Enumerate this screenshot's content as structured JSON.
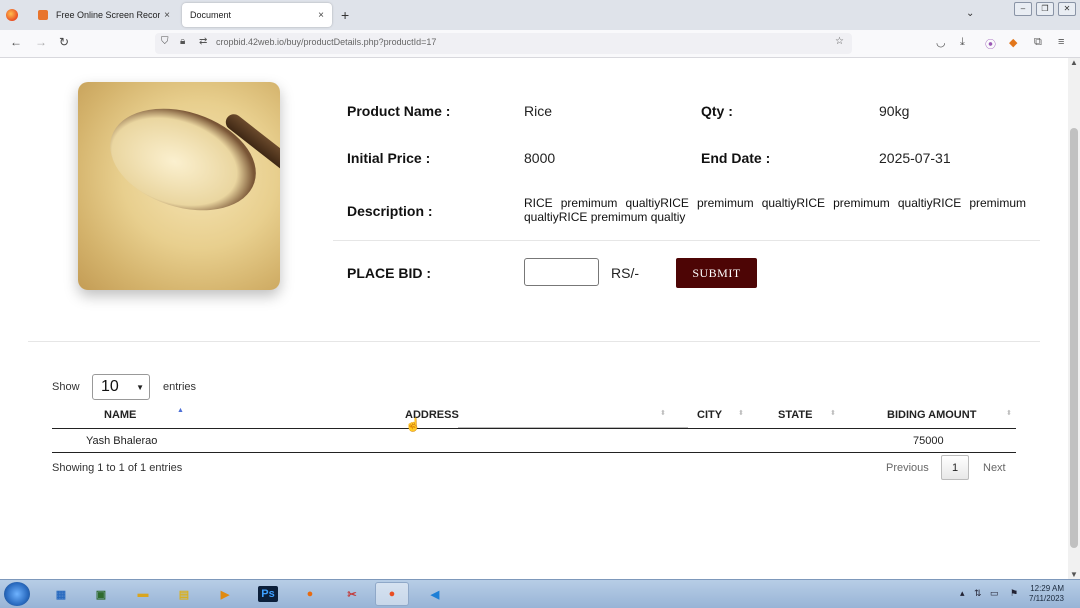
{
  "browser": {
    "tabs": [
      {
        "label": "Free Online Screen Recorder & ",
        "active": false
      },
      {
        "label": "Document",
        "active": true
      }
    ],
    "new_tab": "+",
    "close": "×",
    "url": "cropbid.42web.io/buy/productDetails.php?productId=17"
  },
  "product": {
    "name_label": "Product Name :",
    "name": "Rice",
    "qty_label": "Qty :",
    "qty": "90kg",
    "price_label": "Initial Price :",
    "price": "8000",
    "end_label": "End Date :",
    "end_date": "2025-07-31",
    "desc_label": "Description :",
    "description": "RICE premimum qualtiyRICE premimum qualtiyRICE premimum qualtiyRICE premimum qualtiyRICE premimum qualtiy"
  },
  "bid": {
    "label": "PLACE BID :",
    "input_value": "",
    "currency": "RS/-",
    "submit": "SUBMIT"
  },
  "table": {
    "show_label": "Show",
    "page_size": "10",
    "entries_label": "entries",
    "columns": [
      "NAME",
      "ADDRESS",
      "CITY",
      "STATE",
      "BIDING AMOUNT"
    ],
    "rows": [
      {
        "name": "Yash Bhalerao",
        "address": "",
        "city": "",
        "state": "",
        "amount": "75000"
      }
    ],
    "info": "Showing 1 to 1 of 1 entries",
    "previous": "Previous",
    "current_page": "1",
    "next": "Next"
  },
  "taskbar": {
    "apps": [
      "desktop-icon",
      "terminal-icon",
      "folder-icon",
      "files-icon",
      "media-icon",
      "Ps",
      "fl-studio-icon",
      "snipping-icon",
      "firefox-icon",
      "vscode-icon"
    ],
    "time": "12:29 AM",
    "date": "7/11/2023"
  },
  "colors": {
    "submit_bg": "#4d0505",
    "sort_active": "#4d6fd6"
  }
}
